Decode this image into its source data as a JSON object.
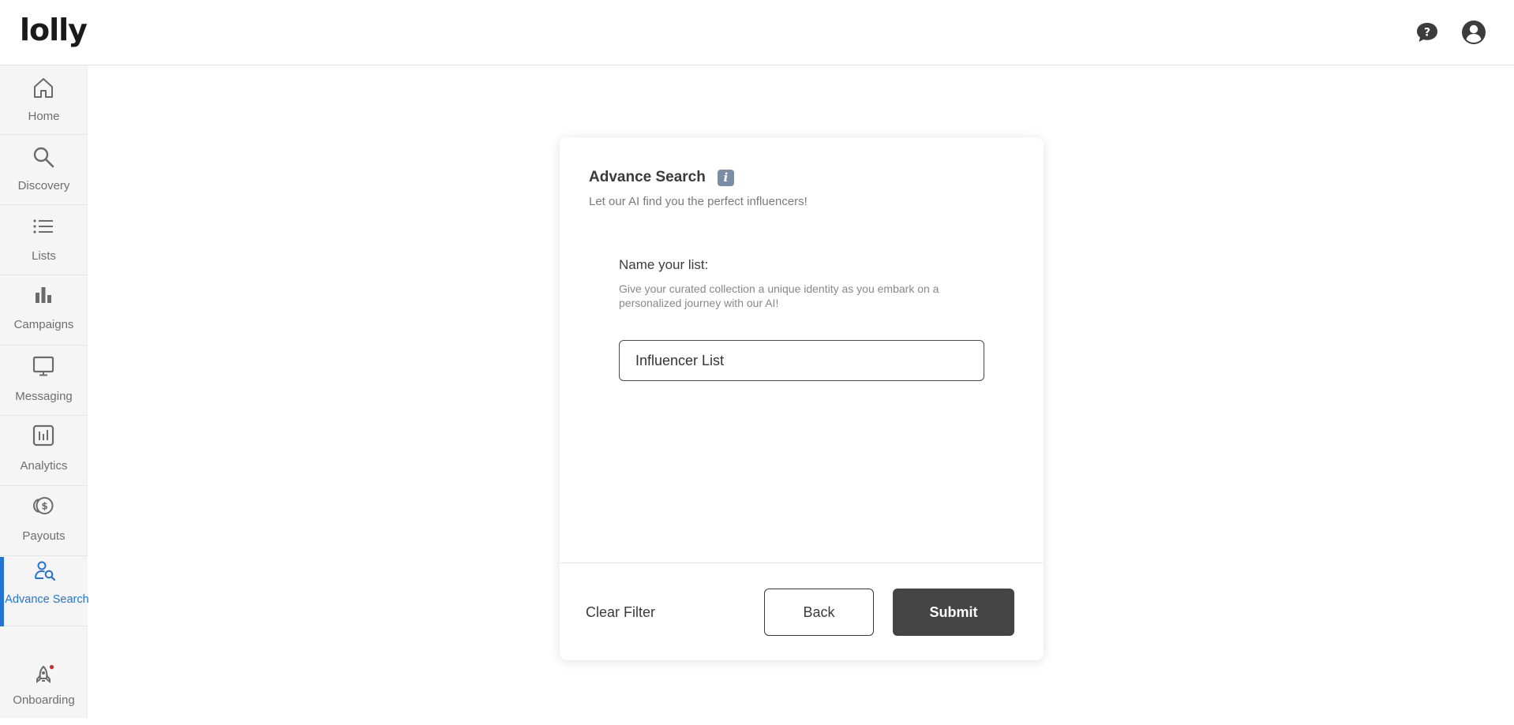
{
  "app": {
    "logo": "lolly"
  },
  "header": {
    "help_icon": "help-chat-icon",
    "user_icon": "user-account-icon"
  },
  "sidebar": {
    "items": [
      {
        "label": "Home",
        "icon": "home-icon"
      },
      {
        "label": "Discovery",
        "icon": "search-icon"
      },
      {
        "label": "Lists",
        "icon": "list-icon"
      },
      {
        "label": "Campaigns",
        "icon": "bar-chart-icon"
      },
      {
        "label": "Messaging",
        "icon": "monitor-icon"
      },
      {
        "label": "Analytics",
        "icon": "analytics-icon"
      },
      {
        "label": "Payouts",
        "icon": "coins-icon"
      },
      {
        "label": "Advance Search",
        "icon": "user-search-icon",
        "active": true
      },
      {
        "label": "Onboarding",
        "icon": "rocket-icon",
        "badge": true
      }
    ],
    "active_color": "#2474d6",
    "badge_color": "#e02424"
  },
  "card": {
    "title": "Advance Search",
    "info_glyph": "i",
    "subtitle": "Let our AI find you the perfect influencers!",
    "field_label": "Name your list:",
    "field_help": "Give your curated collection a unique identity as you embark on a personalized journey with our AI!",
    "input_value": "Influencer List",
    "clear_label": "Clear Filter",
    "back_label": "Back",
    "submit_label": "Submit"
  }
}
